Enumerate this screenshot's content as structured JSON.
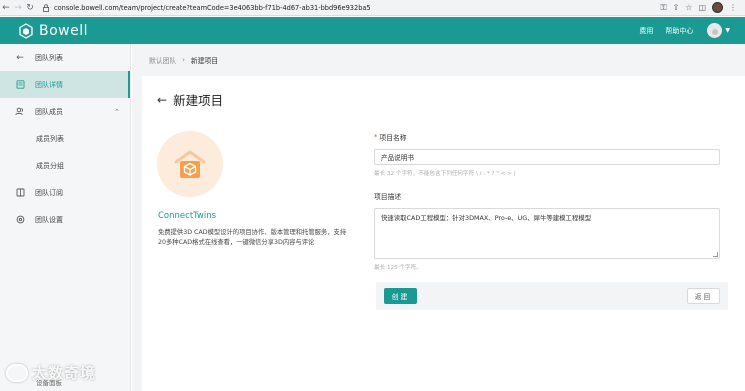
{
  "browser": {
    "url": "console.bowell.com/team/project/create?teamCode=3e4063bb-f71b-4d67-ab31-bbd96e932ba5"
  },
  "header": {
    "logo_text": "Bowell",
    "pricing": "费用",
    "help": "帮助中心",
    "accent": "#1a9a92"
  },
  "sidebar": {
    "items": [
      {
        "label": "团队列表",
        "icon": "arrow-left-icon"
      },
      {
        "label": "团队详情",
        "icon": "document-icon"
      },
      {
        "label": "团队成员",
        "icon": "users-icon"
      },
      {
        "label": "成员列表"
      },
      {
        "label": "成员分组"
      },
      {
        "label": "团队订阅",
        "icon": "book-icon"
      },
      {
        "label": "团队设置",
        "icon": "gear-icon"
      }
    ],
    "bottom": "设备面板"
  },
  "breadcrumb": {
    "parent": "默认团队",
    "current": "新建项目"
  },
  "page": {
    "title": "新建项目"
  },
  "app": {
    "name": "ConnectTwins",
    "description": "免费提供3D CAD模型设计的项目协作、版本管理和托管服务，支持20多种CAD格式在线查看，一键微信分享3D内容与评论"
  },
  "form": {
    "name_label": "项目名称",
    "name_value": "产品说明书",
    "name_hint": "最长 32 个字符，不能包含下列任何字符 \\ / : * ? \" < > |",
    "desc_label": "项目描述",
    "desc_value": "快速读取CAD工程模型：针对3DMAX、Pro-e、UG、犀牛等建模工程模型",
    "desc_hint": "最长 125 个字符。"
  },
  "actions": {
    "create": "创建",
    "back": "返回"
  },
  "watermark": {
    "text": "太数奇境"
  }
}
